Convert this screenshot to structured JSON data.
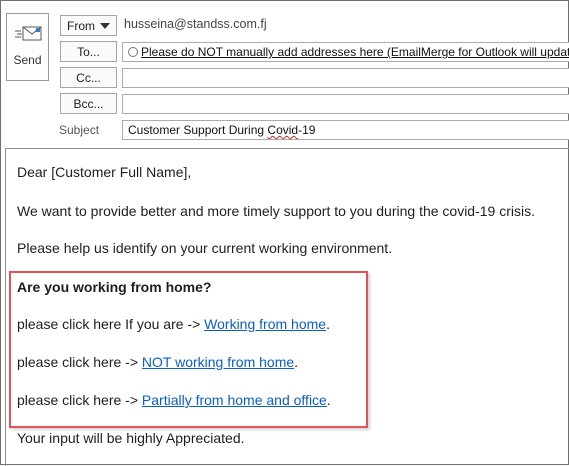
{
  "header": {
    "send_label": "Send",
    "from_label": "From",
    "from_address": "husseina@standss.com.fj",
    "to_label": "To...",
    "to_value": "Please do NOT manually add addresses here (EmailMerge for Outlook will update it",
    "cc_label": "Cc...",
    "cc_value": "",
    "bcc_label": "Bcc...",
    "bcc_value": "",
    "subject_label": "Subject",
    "subject_before": "Customer Support During ",
    "subject_misspelled": "Covid",
    "subject_after": "-19"
  },
  "body": {
    "greeting": "Dear [Customer Full Name],",
    "para1": "We want to provide better and more timely support to you during the covid-19 crisis.",
    "para2": "Please help us identify on your current working environment.",
    "question": "Are you working from home?",
    "option1_text": "please click here If you are -> ",
    "option1_link": "Working from home",
    "option2_text": "please click here -> ",
    "option2_link": "NOT working from home",
    "option3_text": "please click here -> ",
    "option3_link": "Partially from home and office",
    "closing": "Your input will be highly Appreciated.",
    "period": "."
  },
  "colors": {
    "link": "#0b5ec6",
    "highlight_border": "#e2545a",
    "spell_underline": "#d12424"
  },
  "icons": {
    "send": "send-envelope-icon",
    "from_dropdown": "chevron-down-icon"
  }
}
